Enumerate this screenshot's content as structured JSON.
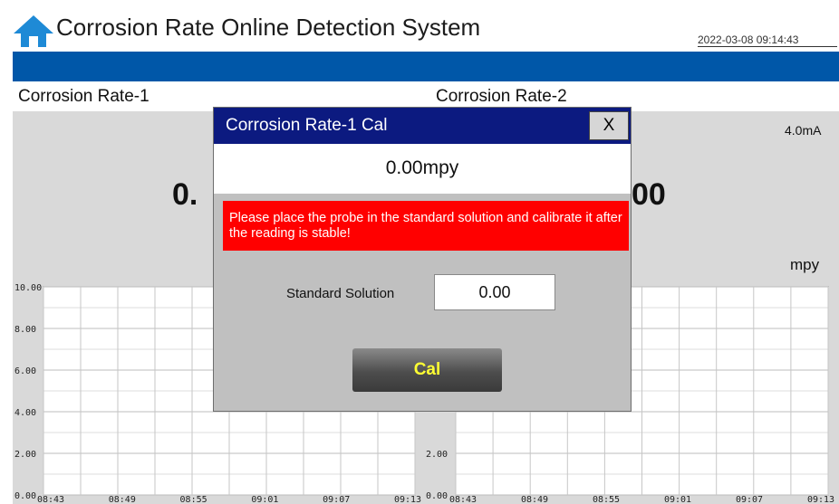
{
  "header": {
    "title": "Corrosion Rate Online Detection System",
    "datetime": "2022-03-08 09:14:43",
    "home_icon": "home-icon"
  },
  "colors": {
    "header_bar": "#0057a8",
    "dialog_titlebar": "#0c1a80",
    "warning_bg": "#ff0000",
    "cal_text": "#ffff33",
    "panel_bg": "#d9d9d9"
  },
  "panels": [
    {
      "title": "Corrosion Rate-1",
      "value_visible": "0.",
      "chart": {
        "y_ticks": [
          "10.00",
          "8.00",
          "6.00",
          "4.00",
          "2.00",
          "0.00"
        ],
        "x_ticks": [
          "08:43",
          "08:49",
          "08:55",
          "09:01",
          "09:07",
          "09:13"
        ]
      }
    },
    {
      "title": "Corrosion Rate-2",
      "current": "4.0mA",
      "value_visible": "00",
      "unit": "mpy",
      "chart": {
        "y_ticks_visible": [
          "2.00",
          "0.00"
        ],
        "x_ticks": [
          "08:43",
          "08:49",
          "08:55",
          "09:01",
          "09:07",
          "09:13"
        ]
      }
    }
  ],
  "dialog": {
    "title": "Corrosion Rate-1 Cal",
    "close_label": "X",
    "reading": "0.00mpy",
    "warning": "Please place the probe in the standard solution and calibrate it after the reading is stable!",
    "standard_label": "Standard Solution",
    "standard_value": "0.00",
    "cal_label": "Cal"
  }
}
